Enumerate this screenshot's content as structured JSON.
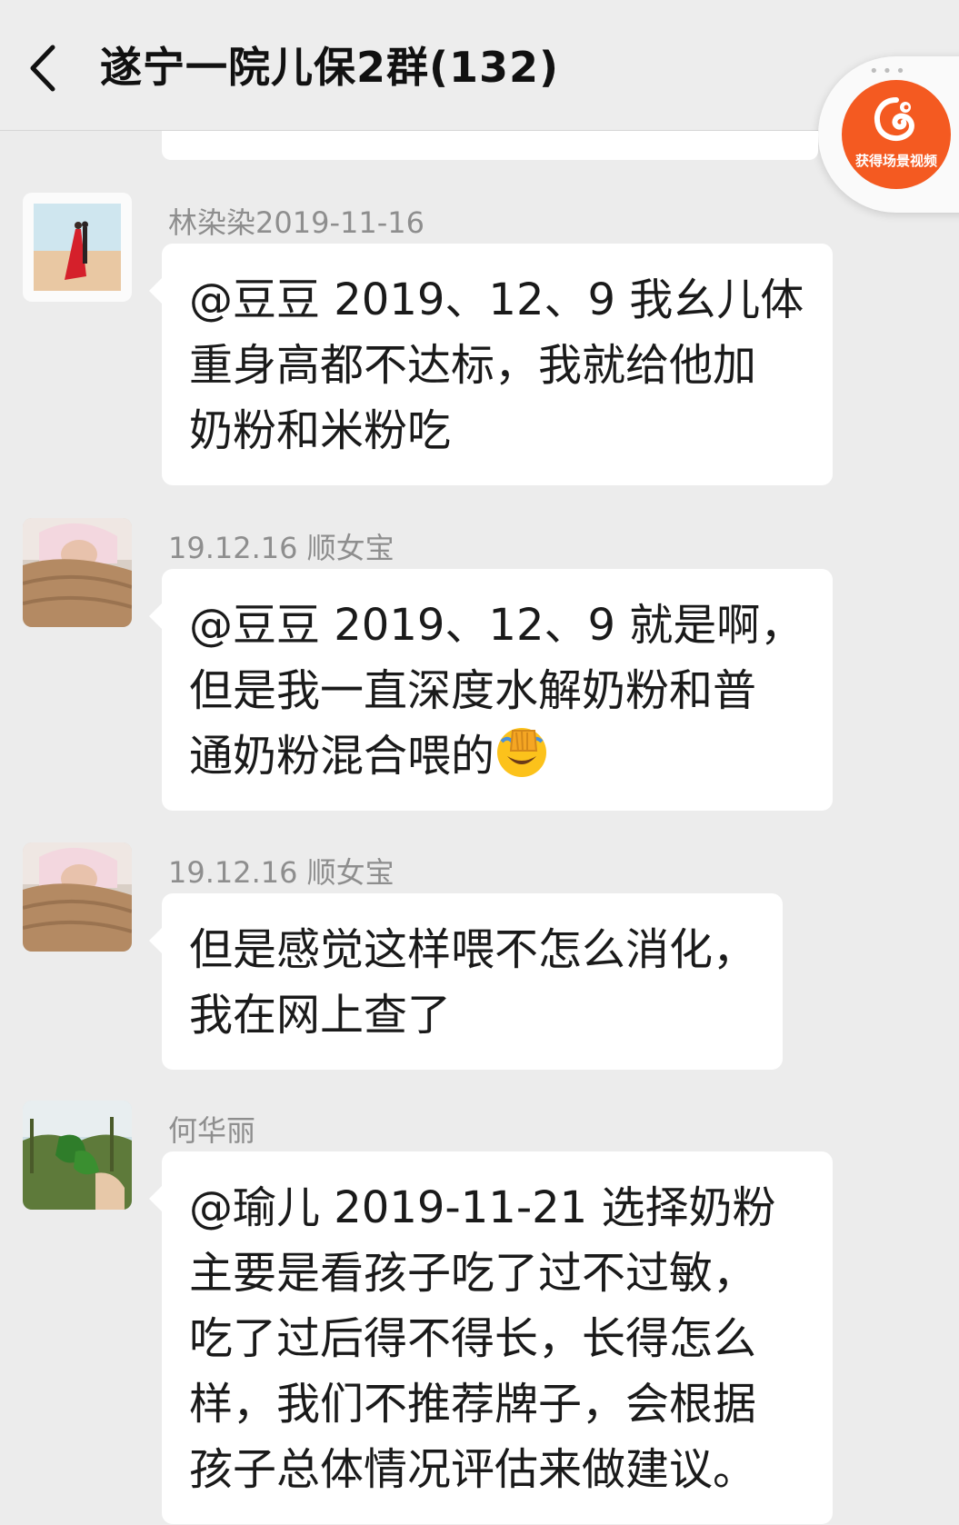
{
  "header": {
    "title": "遂宁一院儿保2群(132)"
  },
  "floating_widget": {
    "label": "获得场景视频",
    "dots": "•••",
    "color": "#f45a21"
  },
  "messages": [
    {
      "sender": "林染染2019-11-16",
      "lines": [
        "@豆豆 2019、12、9  我幺儿体",
        "重身高都不达标，我就给他加",
        "奶粉和米粉吃"
      ],
      "avatar": "avatar-bride-icon"
    },
    {
      "sender": "19.12.16 顺女宝",
      "lines": [
        "@豆豆 2019、12、9  就是啊，",
        "但是我一直深度水解奶粉和普",
        "通奶粉混合喂的"
      ],
      "emoji": "face-palm-crying-emoji",
      "avatar": "avatar-baby-icon"
    },
    {
      "sender": "19.12.16 顺女宝",
      "lines": [
        "但是感觉这样喂不怎么消化，",
        "我在网上查了"
      ],
      "avatar": "avatar-baby-icon"
    },
    {
      "sender": "何华丽",
      "lines": [
        "@瑜儿    2019-11-21  选择奶粉",
        "主要是看孩子吃了过不过敏，",
        "吃了过后得不得长，长得怎么",
        "样，我们不推荐牌子，会根据",
        "孩子总体情况评估来做建议。"
      ],
      "avatar": "avatar-leaf-icon"
    }
  ]
}
